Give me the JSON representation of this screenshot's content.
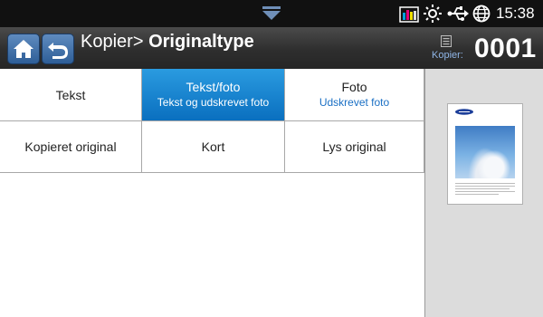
{
  "status_bar": {
    "time": "15:38",
    "icons": [
      "pulldown-arrow-icon",
      "toner-level-icon",
      "brightness-icon",
      "usb-icon",
      "network-globe-icon"
    ]
  },
  "title_bar": {
    "breadcrumb_parent": "Kopier>",
    "page_title": "Originaltype",
    "copies_label": "Kopier:",
    "copies_count": "0001",
    "icons": [
      "home-icon",
      "back-icon",
      "copies-icon"
    ]
  },
  "options": [
    {
      "label": "Tekst",
      "sublabel": "",
      "selected": false
    },
    {
      "label": "Tekst/foto",
      "sublabel": "Tekst og udskrevet foto",
      "selected": true
    },
    {
      "label": "Foto",
      "sublabel": "Udskrevet foto",
      "selected": false
    },
    {
      "label": "Kopieret original",
      "sublabel": "",
      "selected": false
    },
    {
      "label": "Kort",
      "sublabel": "",
      "selected": false
    },
    {
      "label": "Lys original",
      "sublabel": "",
      "selected": false
    }
  ],
  "preview": {
    "icons": [
      "document-preview-icon",
      "samsung-logo-icon"
    ]
  },
  "colors": {
    "selected_bg": "#1a86d3",
    "sublabel": "#1a6fc4",
    "titlebar": "#333333",
    "statusbar": "#111111",
    "preview_bg": "#dcdcdc"
  }
}
